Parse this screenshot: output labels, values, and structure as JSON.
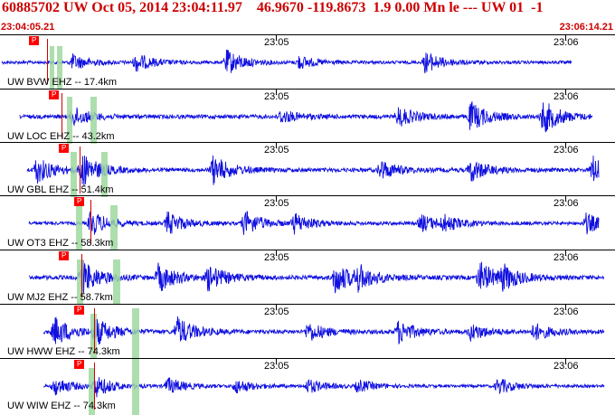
{
  "header": {
    "title": "60885702 UW Oct 05, 2014 23:04:11.97    46.9670 -119.8673  1.9 0.00 Mn le --- UW 01  -1",
    "start_time": "23:04:05.21",
    "end_time": "23:06:14.21"
  },
  "colors": {
    "trace": "#1010e0",
    "pick": "#ff0000",
    "header_text": "#cc0000",
    "shade": "#9fd89f"
  },
  "ticks": [
    "23:05",
    "23:06"
  ],
  "pick_label": "P",
  "stations": [
    {
      "label": "UW BVW EHZ -- 17.4km",
      "amplitude": 0.55,
      "style": "continuous"
    },
    {
      "label": "UW LOC EHZ -- 43.2km",
      "amplitude": 0.7,
      "style": "growing"
    },
    {
      "label": "UW GBL EHZ -- 51.4km",
      "amplitude": 0.7,
      "style": "bursty"
    },
    {
      "label": "UW OT3 EHZ -- 58.3km",
      "amplitude": 0.6,
      "style": "bursts"
    },
    {
      "label": "UW MJ2 EHZ -- 58.7km",
      "amplitude": 0.75,
      "style": "bursts"
    },
    {
      "label": "UW HWW EHZ -- 74.3km",
      "amplitude": 0.7,
      "style": "bursts"
    },
    {
      "label": "UW WIW EHZ -- 74.3km",
      "amplitude": 0.5,
      "style": "bursts"
    }
  ]
}
